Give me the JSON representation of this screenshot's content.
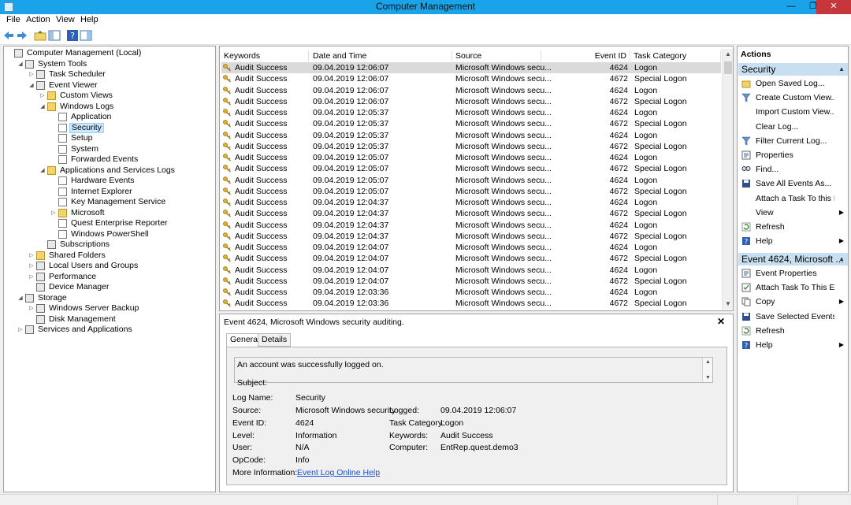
{
  "window": {
    "title": "Computer Management",
    "minimize": "—",
    "restore": "❐",
    "close": "✕"
  },
  "menu": [
    "File",
    "Action",
    "View",
    "Help"
  ],
  "tree": [
    {
      "label": "Computer Management (Local)",
      "level": 0,
      "twisty": "",
      "icon": "computer-icon"
    },
    {
      "label": "System Tools",
      "level": 1,
      "twisty": "◢",
      "icon": "tools-icon"
    },
    {
      "label": "Task Scheduler",
      "level": 2,
      "twisty": "▷",
      "icon": "clock-icon"
    },
    {
      "label": "Event Viewer",
      "level": 2,
      "twisty": "◢",
      "icon": "event-viewer-icon"
    },
    {
      "label": "Custom Views",
      "level": 3,
      "twisty": "▷",
      "icon": "folder-icon"
    },
    {
      "label": "Windows Logs",
      "level": 3,
      "twisty": "◢",
      "icon": "folder-icon"
    },
    {
      "label": "Application",
      "level": 4,
      "twisty": "",
      "icon": "log-icon"
    },
    {
      "label": "Security",
      "level": 4,
      "twisty": "",
      "icon": "log-icon",
      "selected": true
    },
    {
      "label": "Setup",
      "level": 4,
      "twisty": "",
      "icon": "log-icon"
    },
    {
      "label": "System",
      "level": 4,
      "twisty": "",
      "icon": "log-icon"
    },
    {
      "label": "Forwarded Events",
      "level": 4,
      "twisty": "",
      "icon": "log-icon"
    },
    {
      "label": "Applications and Services Logs",
      "level": 3,
      "twisty": "◢",
      "icon": "folder-icon"
    },
    {
      "label": "Hardware Events",
      "level": 4,
      "twisty": "",
      "icon": "log-icon"
    },
    {
      "label": "Internet Explorer",
      "level": 4,
      "twisty": "",
      "icon": "log-icon"
    },
    {
      "label": "Key Management Service",
      "level": 4,
      "twisty": "",
      "icon": "log-icon"
    },
    {
      "label": "Microsoft",
      "level": 4,
      "twisty": "▷",
      "icon": "folder-icon"
    },
    {
      "label": "Quest Enterprise Reporter",
      "level": 4,
      "twisty": "",
      "icon": "log-icon"
    },
    {
      "label": "Windows PowerShell",
      "level": 4,
      "twisty": "",
      "icon": "log-icon"
    },
    {
      "label": "Subscriptions",
      "level": 3,
      "twisty": "",
      "icon": "subscriptions-icon"
    },
    {
      "label": "Shared Folders",
      "level": 2,
      "twisty": "▷",
      "icon": "folder-icon"
    },
    {
      "label": "Local Users and Groups",
      "level": 2,
      "twisty": "▷",
      "icon": "users-icon"
    },
    {
      "label": "Performance",
      "level": 2,
      "twisty": "▷",
      "icon": "performance-icon"
    },
    {
      "label": "Device Manager",
      "level": 2,
      "twisty": "",
      "icon": "device-manager-icon"
    },
    {
      "label": "Storage",
      "level": 1,
      "twisty": "◢",
      "icon": "storage-icon"
    },
    {
      "label": "Windows Server Backup",
      "level": 2,
      "twisty": "▷",
      "icon": "backup-icon"
    },
    {
      "label": "Disk Management",
      "level": 2,
      "twisty": "",
      "icon": "disk-icon"
    },
    {
      "label": "Services and Applications",
      "level": 1,
      "twisty": "▷",
      "icon": "services-icon"
    }
  ],
  "events": {
    "columns": [
      "Keywords",
      "Date and Time",
      "Source",
      "Event ID",
      "Task Category"
    ],
    "rows": [
      [
        "Audit Success",
        "09.04.2019 12:06:07",
        "Microsoft Windows secu...",
        "4624",
        "Logon"
      ],
      [
        "Audit Success",
        "09.04.2019 12:06:07",
        "Microsoft Windows secu...",
        "4672",
        "Special Logon"
      ],
      [
        "Audit Success",
        "09.04.2019 12:06:07",
        "Microsoft Windows secu...",
        "4624",
        "Logon"
      ],
      [
        "Audit Success",
        "09.04.2019 12:06:07",
        "Microsoft Windows secu...",
        "4672",
        "Special Logon"
      ],
      [
        "Audit Success",
        "09.04.2019 12:05:37",
        "Microsoft Windows secu...",
        "4624",
        "Logon"
      ],
      [
        "Audit Success",
        "09.04.2019 12:05:37",
        "Microsoft Windows secu...",
        "4672",
        "Special Logon"
      ],
      [
        "Audit Success",
        "09.04.2019 12:05:37",
        "Microsoft Windows secu...",
        "4624",
        "Logon"
      ],
      [
        "Audit Success",
        "09.04.2019 12:05:37",
        "Microsoft Windows secu...",
        "4672",
        "Special Logon"
      ],
      [
        "Audit Success",
        "09.04.2019 12:05:07",
        "Microsoft Windows secu...",
        "4624",
        "Logon"
      ],
      [
        "Audit Success",
        "09.04.2019 12:05:07",
        "Microsoft Windows secu...",
        "4672",
        "Special Logon"
      ],
      [
        "Audit Success",
        "09.04.2019 12:05:07",
        "Microsoft Windows secu...",
        "4624",
        "Logon"
      ],
      [
        "Audit Success",
        "09.04.2019 12:05:07",
        "Microsoft Windows secu...",
        "4672",
        "Special Logon"
      ],
      [
        "Audit Success",
        "09.04.2019 12:04:37",
        "Microsoft Windows secu...",
        "4624",
        "Logon"
      ],
      [
        "Audit Success",
        "09.04.2019 12:04:37",
        "Microsoft Windows secu...",
        "4672",
        "Special Logon"
      ],
      [
        "Audit Success",
        "09.04.2019 12:04:37",
        "Microsoft Windows secu...",
        "4624",
        "Logon"
      ],
      [
        "Audit Success",
        "09.04.2019 12:04:37",
        "Microsoft Windows secu...",
        "4672",
        "Special Logon"
      ],
      [
        "Audit Success",
        "09.04.2019 12:04:07",
        "Microsoft Windows secu...",
        "4624",
        "Logon"
      ],
      [
        "Audit Success",
        "09.04.2019 12:04:07",
        "Microsoft Windows secu...",
        "4672",
        "Special Logon"
      ],
      [
        "Audit Success",
        "09.04.2019 12:04:07",
        "Microsoft Windows secu...",
        "4624",
        "Logon"
      ],
      [
        "Audit Success",
        "09.04.2019 12:04:07",
        "Microsoft Windows secu...",
        "4672",
        "Special Logon"
      ],
      [
        "Audit Success",
        "09.04.2019 12:03:36",
        "Microsoft Windows secu...",
        "4624",
        "Logon"
      ],
      [
        "Audit Success",
        "09.04.2019 12:03:36",
        "Microsoft Windows secu...",
        "4672",
        "Special Logon"
      ]
    ]
  },
  "detail": {
    "title": "Event 4624, Microsoft Windows security auditing.",
    "close": "✕",
    "tabs": [
      "General",
      "Details"
    ],
    "description_line1": "An account was successfully logged on.",
    "description_line2": "Subject:",
    "fields": {
      "log_name_label": "Log Name:",
      "log_name": "Security",
      "source_label": "Source:",
      "source": "Microsoft Windows security",
      "logged_label": "Logged:",
      "logged": "09.04.2019 12:06:07",
      "event_id_label": "Event ID:",
      "event_id": "4624",
      "task_category_label": "Task Category:",
      "task_category": "Logon",
      "level_label": "Level:",
      "level": "Information",
      "keywords_label": "Keywords:",
      "keywords": "Audit Success",
      "user_label": "User:",
      "user": "N/A",
      "computer_label": "Computer:",
      "computer": "EntRep.quest.demo3",
      "opcode_label": "OpCode:",
      "opcode": "Info",
      "more_info_label": "More Information:",
      "more_info_link": "Event Log Online Help"
    }
  },
  "actions": {
    "header": "Actions",
    "section1_title": "Security",
    "section1": [
      {
        "label": "Open Saved Log...",
        "icon": "open-log-icon",
        "submenu": false
      },
      {
        "label": "Create Custom View...",
        "icon": "filter-icon",
        "submenu": false
      },
      {
        "label": "Import Custom View...",
        "icon": "",
        "submenu": false
      },
      {
        "label": "Clear Log...",
        "icon": "",
        "submenu": false
      },
      {
        "label": "Filter Current Log...",
        "icon": "filter-icon",
        "submenu": false
      },
      {
        "label": "Properties",
        "icon": "properties-icon",
        "submenu": false
      },
      {
        "label": "Find...",
        "icon": "find-icon",
        "submenu": false
      },
      {
        "label": "Save All Events As...",
        "icon": "save-icon",
        "submenu": false
      },
      {
        "label": "Attach a Task To this L...",
        "icon": "",
        "submenu": false
      },
      {
        "label": "View",
        "icon": "",
        "submenu": true
      },
      {
        "label": "Refresh",
        "icon": "refresh-icon",
        "submenu": false
      },
      {
        "label": "Help",
        "icon": "help-icon",
        "submenu": true
      }
    ],
    "section2_title": "Event 4624, Microsoft ...",
    "section2": [
      {
        "label": "Event Properties",
        "icon": "properties-icon",
        "submenu": false
      },
      {
        "label": "Attach Task To This Ev...",
        "icon": "task-icon",
        "submenu": false
      },
      {
        "label": "Copy",
        "icon": "copy-icon",
        "submenu": true
      },
      {
        "label": "Save Selected Events...",
        "icon": "save-icon",
        "submenu": false
      },
      {
        "label": "Refresh",
        "icon": "refresh-icon",
        "submenu": false
      },
      {
        "label": "Help",
        "icon": "help-icon",
        "submenu": true
      }
    ]
  },
  "colors": {
    "titlebar": "#1aa3e8",
    "close_button": "#c7363a",
    "selection": "#cce8ff",
    "action_section": "#c7dff0",
    "link": "#1a4fd6"
  }
}
